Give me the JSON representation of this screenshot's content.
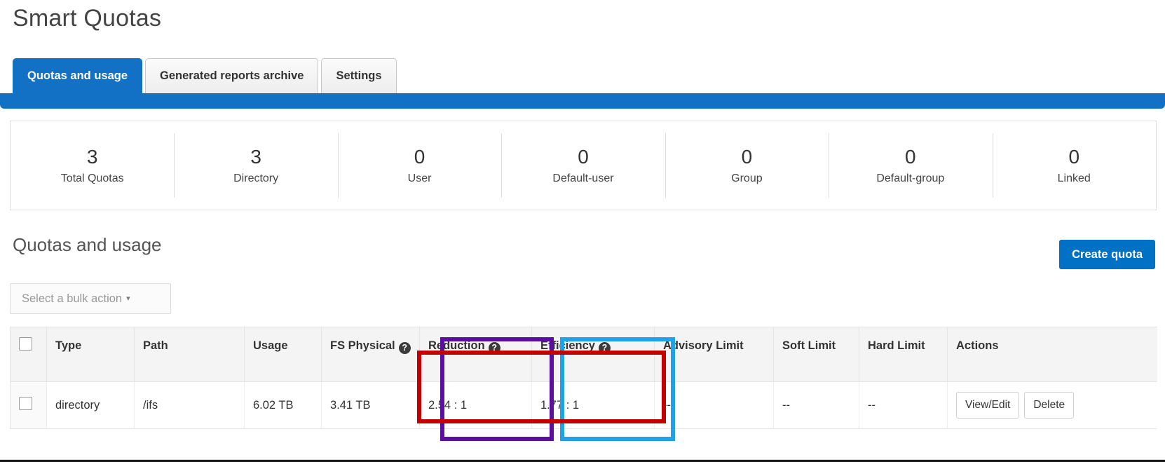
{
  "page": {
    "title": "Smart Quotas"
  },
  "tabs": [
    {
      "label": "Quotas and usage",
      "active": true
    },
    {
      "label": "Generated reports archive",
      "active": false
    },
    {
      "label": "Settings",
      "active": false
    }
  ],
  "summary": [
    {
      "value": "3",
      "label": "Total Quotas"
    },
    {
      "value": "3",
      "label": "Directory"
    },
    {
      "value": "0",
      "label": "User"
    },
    {
      "value": "0",
      "label": "Default-user"
    },
    {
      "value": "0",
      "label": "Group"
    },
    {
      "value": "0",
      "label": "Default-group"
    },
    {
      "value": "0",
      "label": "Linked"
    }
  ],
  "section": {
    "title": "Quotas and usage",
    "create_button": "Create quota",
    "bulk_action_label": "Select a bulk action",
    "bulk_action_caret": "▾"
  },
  "table": {
    "headers": [
      {
        "label": "",
        "help": false
      },
      {
        "label": "Type",
        "help": false
      },
      {
        "label": "Path",
        "help": false
      },
      {
        "label": "Usage",
        "help": false
      },
      {
        "label": "FS Physical",
        "help": true
      },
      {
        "label": "Reduction",
        "help": true
      },
      {
        "label": "Efficiency",
        "help": true
      },
      {
        "label": "Advisory Limit",
        "help": false
      },
      {
        "label": "Soft Limit",
        "help": false
      },
      {
        "label": "Hard Limit",
        "help": false
      },
      {
        "label": "Actions",
        "help": false
      }
    ],
    "help_glyph": "?",
    "rows": [
      {
        "type": "directory",
        "path": "/ifs",
        "usage": "6.02 TB",
        "fs_physical": "3.41 TB",
        "reduction": "2.54 : 1",
        "efficiency": "1.77 : 1",
        "advisory_limit": "--",
        "soft_limit": "--",
        "hard_limit": "--",
        "actions": [
          "View/Edit",
          "Delete"
        ]
      }
    ]
  },
  "annotations": [
    {
      "name": "reduction-column-highlight",
      "color": "#5b0f9e"
    },
    {
      "name": "efficiency-column-highlight",
      "color": "#21a2e8"
    },
    {
      "name": "ratio-values-highlight",
      "color": "#c20000"
    }
  ],
  "colors": {
    "accent_blue": "#1271c4",
    "button_blue": "#0071c5",
    "annotation_purple": "#5b0f9e",
    "annotation_cyan": "#21a2e8",
    "annotation_red": "#c20000"
  }
}
